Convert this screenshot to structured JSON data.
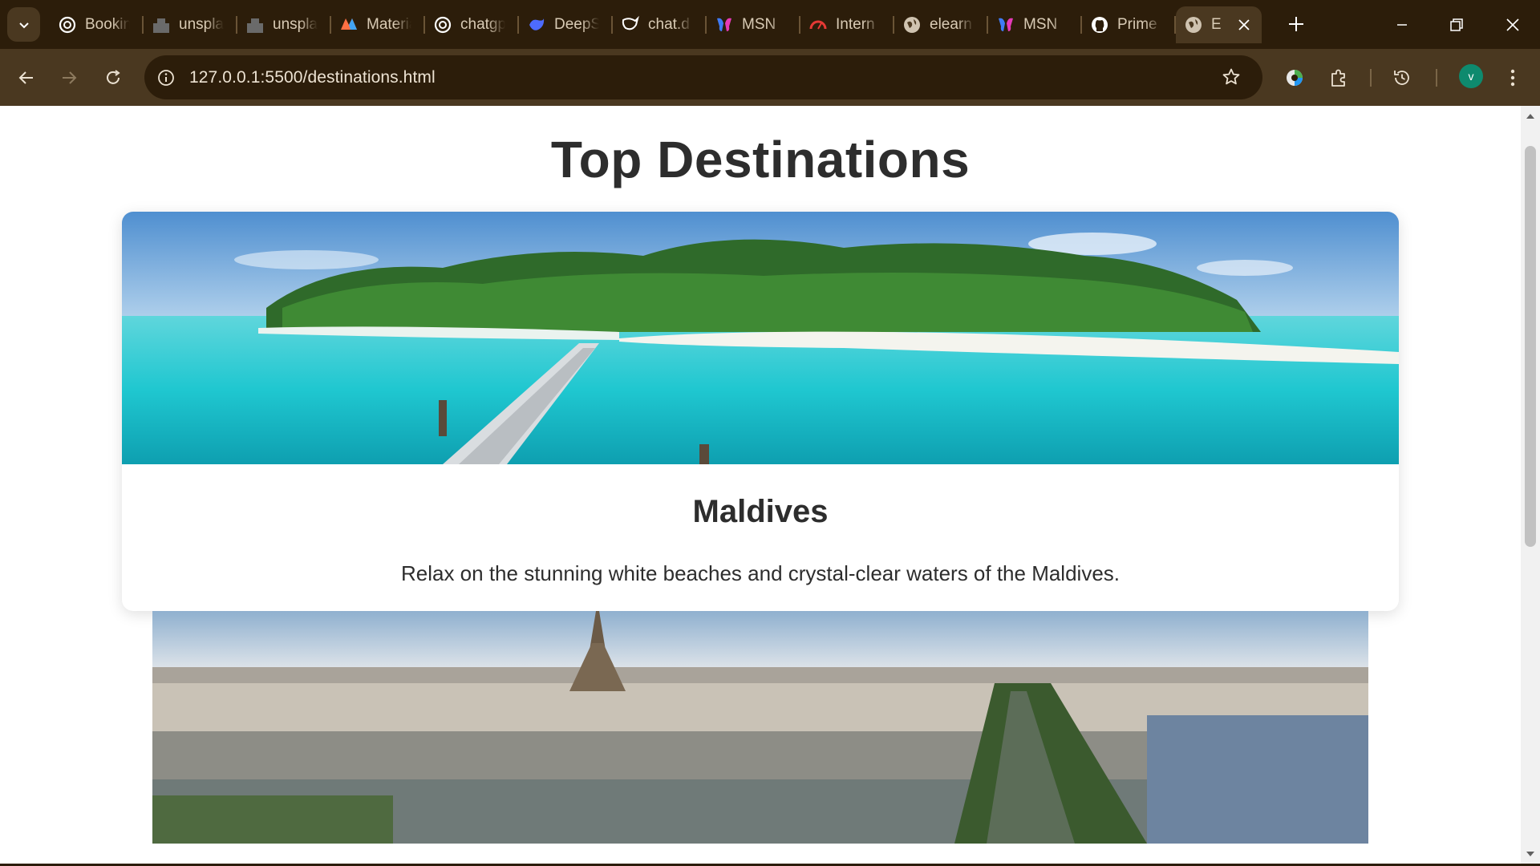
{
  "browser": {
    "tabs": [
      {
        "title": "Booking",
        "icon": "openai-icon"
      },
      {
        "title": "unsplash",
        "icon": "unsplash-icon"
      },
      {
        "title": "unsplash",
        "icon": "unsplash-icon"
      },
      {
        "title": "Material",
        "icon": "material-icon"
      },
      {
        "title": "chatgpt",
        "icon": "openai-icon"
      },
      {
        "title": "DeepSeek",
        "icon": "deepseek-icon"
      },
      {
        "title": "chat.d",
        "icon": "chat-icon"
      },
      {
        "title": "MSN",
        "icon": "msn-icon"
      },
      {
        "title": "Intern",
        "icon": "gauge-icon"
      },
      {
        "title": "elearn",
        "icon": "globe-icon"
      },
      {
        "title": "MSN",
        "icon": "msn-icon"
      },
      {
        "title": "Prime",
        "icon": "github-icon"
      }
    ],
    "active_tab": {
      "title": "E",
      "icon": "globe-icon"
    },
    "url": "127.0.0.1:5500/destinations.html",
    "profile_initial": "v",
    "accent": "#0e8a6e",
    "frame_color": "#2c1d0a",
    "toolbar_color": "#4a3820"
  },
  "page": {
    "title": "Top Destinations",
    "destinations": [
      {
        "name": "Maldives",
        "description": "Relax on the stunning white beaches and crystal-clear waters of the Maldives.",
        "image": "maldives-beach-image"
      },
      {
        "name": "",
        "description": "",
        "image": "paris-cityscape-image"
      }
    ]
  }
}
